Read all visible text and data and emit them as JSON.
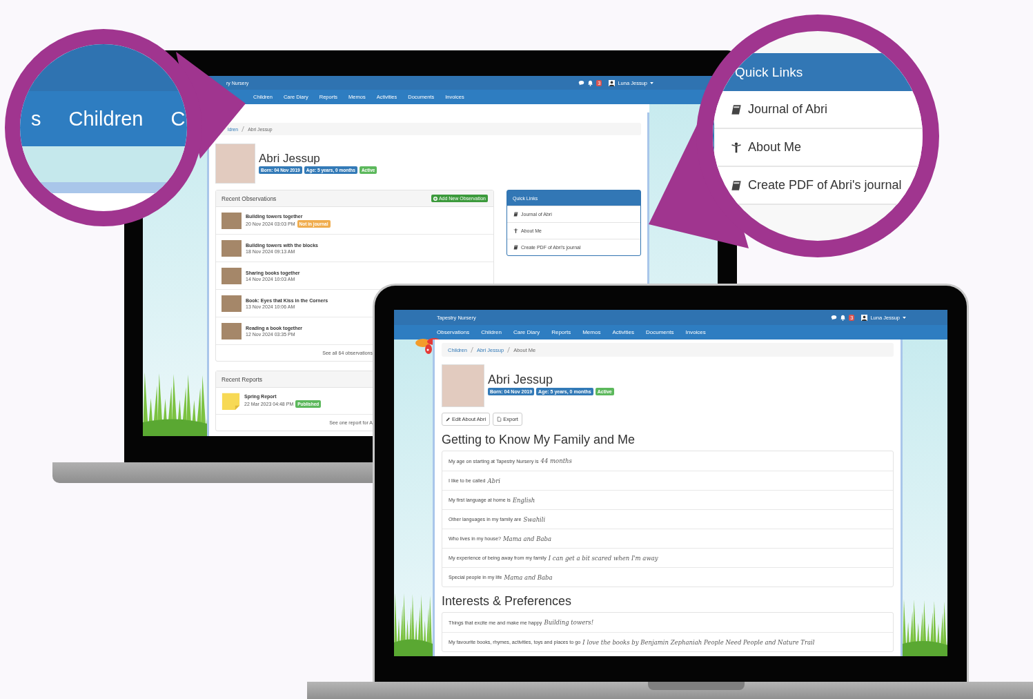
{
  "zoom_nav": {
    "items": [
      "s",
      "Children",
      "C"
    ]
  },
  "zoom_quick_links": {
    "title": "Quick Links",
    "links": [
      {
        "kind": "book",
        "label": "Journal of Abri"
      },
      {
        "kind": "person",
        "label": "About Me"
      },
      {
        "kind": "book",
        "label": "Create PDF of Abri's journal"
      }
    ]
  },
  "back_screen": {
    "brand": "ry Nursery",
    "notifications": "3",
    "user": "Luna Jessup",
    "nav": [
      "Children",
      "Care Diary",
      "Reports",
      "Memos",
      "Activities",
      "Documents",
      "Invoices"
    ],
    "breadcrumb": [
      "ldren",
      "Abri Jessup"
    ],
    "child": {
      "name": "Abri Jessup",
      "badges": [
        {
          "kind": "primary",
          "text": "Born: 04 Nov 2019"
        },
        {
          "kind": "primary",
          "text": "Age: 5 years, 0 months"
        },
        {
          "kind": "success",
          "text": "Active"
        }
      ]
    },
    "observations": {
      "title": "Recent Observations",
      "button": "Add New Observation",
      "items": [
        {
          "title": "Building towers together",
          "date": "20 Nov 2024 03:03 PM",
          "badge": {
            "kind": "warning",
            "text": "Not in journal"
          }
        },
        {
          "title": "Building towers with the blocks",
          "date": "18 Nov 2024 09:13 AM"
        },
        {
          "title": "Sharing books together",
          "date": "14 Nov 2024 10:03 AM"
        },
        {
          "title": "Book: Eyes that Kiss in the Corners",
          "date": "13 Nov 2024 10:06 AM"
        },
        {
          "title": "Reading a book together",
          "date": "12 Nov 2024 03:35 PM"
        }
      ],
      "footer": "See all 64 observations"
    },
    "reports": {
      "title": "Recent Reports",
      "items": [
        {
          "title": "Spring Report",
          "date": "22 Mar 2023 04:48 PM",
          "badge": {
            "kind": "success",
            "text": "Published"
          }
        }
      ],
      "footer": "See one report for A"
    },
    "quick_links": {
      "title": "Quick Links",
      "links": [
        {
          "kind": "book",
          "label": "Journal of Abri"
        },
        {
          "kind": "person",
          "label": "About Me"
        },
        {
          "kind": "book",
          "label": "Create PDF of Abri's journal"
        }
      ]
    }
  },
  "front_screen": {
    "brand": "Tapestry Nursery",
    "notifications": "3",
    "user": "Luna Jessup",
    "nav": [
      "Observations",
      "Children",
      "Care Diary",
      "Reports",
      "Memos",
      "Activities",
      "Documents",
      "Invoices"
    ],
    "breadcrumb": [
      "Children",
      "Abri Jessup",
      "About Me"
    ],
    "child": {
      "name": "Abri Jessup",
      "badges": [
        {
          "kind": "primary",
          "text": "Born: 04 Nov 2019"
        },
        {
          "kind": "primary",
          "text": "Age: 5 years, 0 months"
        },
        {
          "kind": "success",
          "text": "Active"
        }
      ]
    },
    "buttons": [
      {
        "kind": "pencil",
        "label": "Edit About Abri"
      },
      {
        "kind": "file",
        "label": "Export"
      }
    ],
    "sections": [
      {
        "title": "Getting to Know My Family and Me",
        "rows": [
          {
            "question": "My age on starting at Tapestry Nursery is",
            "answer": "44 months"
          },
          {
            "question": "I like to be called",
            "answer": "Abri"
          },
          {
            "question": "My first language at home is",
            "answer": "English"
          },
          {
            "question": "Other languages in my family are",
            "answer": "Swahili"
          },
          {
            "question": "Who lives in my house?",
            "answer": "Mama and Baba"
          },
          {
            "question": "My experience of being away from my family",
            "answer": "I can get a bit scared when I'm away"
          },
          {
            "question": "Special people in my life",
            "answer": "Mama and Baba"
          }
        ]
      },
      {
        "title": "Interests & Preferences",
        "rows": [
          {
            "question": "Things that excite me and make me happy",
            "answer": "Building towers!"
          },
          {
            "question": "My favourite books, rhymes, activities, toys and places to go",
            "answer": "I love the books by Benjamin Zephaniah People Need People and Nature Trail"
          }
        ]
      }
    ]
  }
}
